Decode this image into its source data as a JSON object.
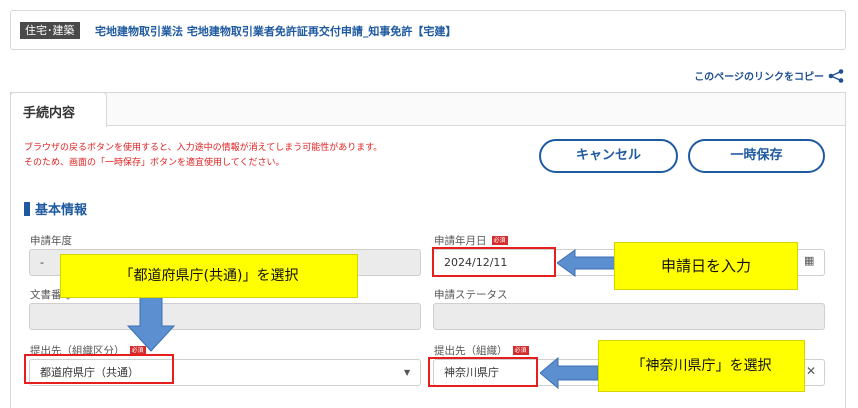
{
  "header": {
    "category": "住宅･建築",
    "procedure_title": "宅地建物取引業法 宅地建物取引業者免許証再交付申請_知事免許【宅建】"
  },
  "copy_link": {
    "label": "このページのリンクをコピー",
    "icon": "share-icon"
  },
  "tabs": [
    {
      "label": "手続内容",
      "active": true
    }
  ],
  "warning": {
    "line1": "ブラウザの戻るボタンを使用すると、入力途中の情報が消えてしまう可能性があります。",
    "line2": "そのため、画面の「一時保存」ボタンを適宜使用してください。"
  },
  "buttons": {
    "cancel": "キャンセル",
    "temp_save": "一時保存"
  },
  "section": {
    "title": "基本情報"
  },
  "fields": {
    "application_year": {
      "label": "申請年度",
      "value": "-",
      "required": false
    },
    "application_date": {
      "label": "申請年月日",
      "value": "2024/12/11",
      "required": true,
      "required_badge": "必須"
    },
    "document_number": {
      "label": "文書番号",
      "value": "",
      "required": false
    },
    "application_status": {
      "label": "申請ステータス",
      "value": "",
      "required": false
    },
    "submit_category": {
      "label": "提出先（組織区分）",
      "value": "都道府県庁（共通）",
      "required": true,
      "required_badge": "必須"
    },
    "submit_org": {
      "label": "提出先（組織）",
      "value": "神奈川県庁",
      "required": true,
      "required_badge": "必須"
    }
  },
  "annotations": {
    "callout_date": "申請日を入力",
    "callout_category": "「都道府県庁(共通)」を選択",
    "callout_org": "「神奈川県庁」を選択",
    "highlight_color": "#e61e1e",
    "callout_color": "#ffff00",
    "arrow_color": "#5b8fd0"
  },
  "colors": {
    "accent": "#1f5aa0",
    "warning": "#e02020"
  }
}
